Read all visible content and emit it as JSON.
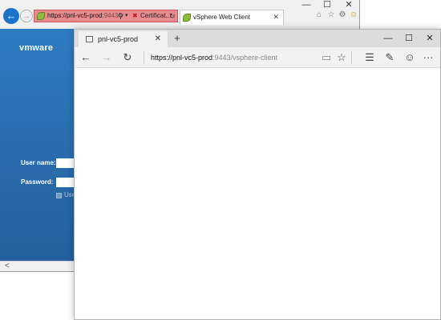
{
  "ie": {
    "window_controls": {
      "minimize": "—",
      "maximize": "☐",
      "close": "✕"
    },
    "address": {
      "host": "https://pnl-vc5-prod",
      "path": ":9443/v",
      "search_glyph": "⚲",
      "dropdown_glyph": "▾"
    },
    "cert_error": {
      "label": "Certificat...",
      "icon_glyph": "✖",
      "refresh_glyph": "↻"
    },
    "tab": {
      "label": "vSphere Web Client",
      "close_glyph": "✕"
    },
    "toolbar_icons": [
      "home-icon",
      "star-icon",
      "gear-icon",
      "smiley-icon"
    ],
    "toolbar_glyphs": {
      "home": "⌂",
      "star": "☆",
      "gear": "⚙",
      "smiley": "☺"
    },
    "back_glyph": "←",
    "forward_glyph": "→",
    "scroll_left_glyph": "<"
  },
  "vmware": {
    "logo": "vmware",
    "username_label": "User name:",
    "password_label": "Password:",
    "checkbox_label": "Use"
  },
  "edge": {
    "tab": {
      "label": "pnl-vc5-prod",
      "close_glyph": "✕"
    },
    "new_tab_glyph": "+",
    "window_controls": {
      "minimize": "—",
      "maximize": "☐",
      "close": "✕"
    },
    "nav": {
      "back": "←",
      "forward": "→",
      "refresh": "↻"
    },
    "url": {
      "host": "https://pnl-vc5-prod",
      "path": ":9443/vsphere-client"
    },
    "toolbar_glyphs": {
      "reading_view": "▭",
      "favorite": "☆",
      "hub": "☰",
      "notes": "✎",
      "feedback": "☺",
      "more": "···"
    }
  },
  "colors": {
    "ie_back_button": "#1c74c9",
    "cert_error_bg": "#e98b8e",
    "vmware_blue": "#2f7cc2"
  }
}
